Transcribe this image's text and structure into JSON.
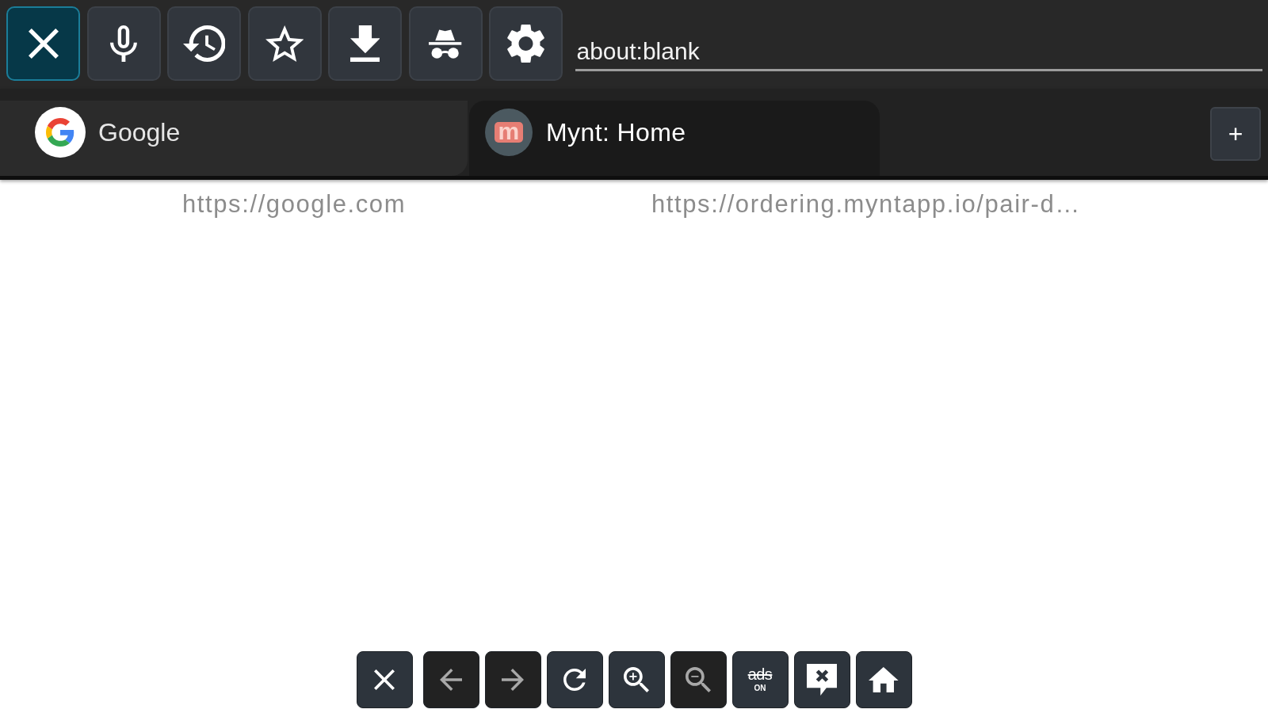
{
  "toolbar": {
    "buttons": [
      {
        "kind": "close",
        "selected": true
      },
      {
        "kind": "microphone",
        "selected": false
      },
      {
        "kind": "history",
        "selected": false
      },
      {
        "kind": "star",
        "selected": false
      },
      {
        "kind": "download",
        "selected": false
      },
      {
        "kind": "incognito",
        "selected": false
      },
      {
        "kind": "settings",
        "selected": false
      }
    ]
  },
  "address_bar": {
    "value": "about:blank"
  },
  "tabs": [
    {
      "title": "Google",
      "url": "https://google.com",
      "favicon": {
        "kind": "google"
      },
      "selected": false
    },
    {
      "title": "Mynt: Home",
      "url": "https://ordering.myntapp.io/pair-d…",
      "favicon": {
        "kind": "letter",
        "text": "m"
      },
      "selected": true
    }
  ],
  "new_tab_button": {
    "label": "+"
  },
  "bottom_bar": {
    "buttons": [
      {
        "kind": "close",
        "disabled": false
      },
      {
        "kind": "back",
        "disabled": true
      },
      {
        "kind": "forward",
        "disabled": true
      },
      {
        "kind": "reload",
        "disabled": false
      },
      {
        "kind": "zoom_in",
        "disabled": false
      },
      {
        "kind": "zoom_out",
        "disabled": true
      },
      {
        "kind": "ads",
        "label": "ads",
        "sublabel": "ON",
        "disabled": false
      },
      {
        "kind": "feedback",
        "disabled": false
      },
      {
        "kind": "home",
        "disabled": false
      }
    ]
  }
}
